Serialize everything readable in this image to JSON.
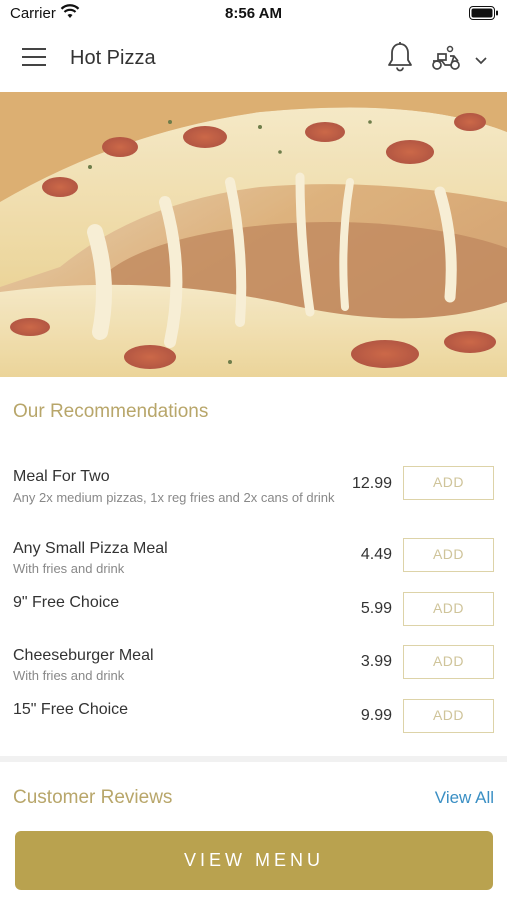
{
  "status_bar": {
    "carrier": "Carrier",
    "time": "8:56 AM"
  },
  "header": {
    "title": "Hot Pizza"
  },
  "recommendations": {
    "title": "Our Recommendations",
    "items": [
      {
        "name": "Meal For Two",
        "description": "Any 2x medium pizzas, 1x reg fries and 2x cans of drink",
        "price": "12.99",
        "button": "ADD"
      },
      {
        "name": "Any Small Pizza Meal",
        "description": "With fries and drink",
        "price": "4.49",
        "button": "ADD"
      },
      {
        "name": "9\" Free Choice",
        "description": "",
        "price": "5.99",
        "button": "ADD"
      },
      {
        "name": "Cheeseburger Meal",
        "description": "With fries and drink",
        "price": "3.99",
        "button": "ADD"
      },
      {
        "name": "15\" Free Choice",
        "description": "",
        "price": "9.99",
        "button": "ADD"
      }
    ]
  },
  "reviews": {
    "title": "Customer Reviews",
    "view_all": "View All"
  },
  "footer": {
    "view_menu": "VIEW MENU"
  },
  "colors": {
    "accent_gold": "#b9a24f",
    "link_blue": "#3a8fc4"
  },
  "icons": [
    "wifi-icon",
    "battery-icon",
    "hamburger-menu-icon",
    "bell-icon",
    "scooter-icon",
    "chevron-down-icon"
  ]
}
